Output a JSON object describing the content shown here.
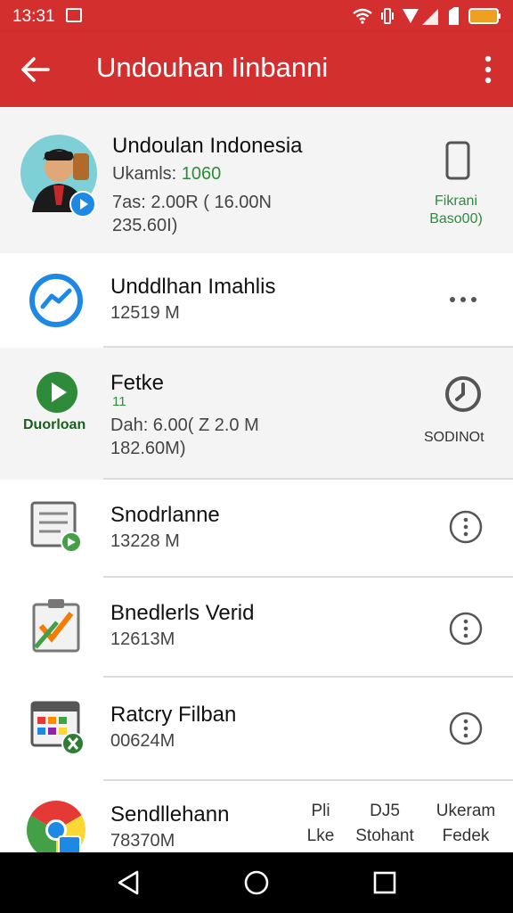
{
  "status_bar": {
    "time": "13:31",
    "icons": [
      "image-notification-icon",
      "wifi-icon",
      "vibrate-icon",
      "signal-icon",
      "sim-icon",
      "battery-icon"
    ],
    "color": "#d32f2f"
  },
  "app_bar": {
    "title": "Undouhan Iinbanni",
    "back_icon": "arrow-back-icon",
    "menu_icon": "more-vert-icon"
  },
  "items": [
    {
      "title": "Undoulan Indonesia",
      "line1_label": "Ukamls:",
      "line1_value": "1060",
      "line2": "7as: 2.00R ( 16.00N",
      "line3": "235.60I)",
      "action_label_1": "Fikrani",
      "action_label_2": "Baso00)",
      "icon": "avatar-photo",
      "action_icon": "phone-icon"
    },
    {
      "title": "Unddlhan Imahlis",
      "line1": "12519 M",
      "icon": "messenger-icon",
      "action_icon": "more-horiz-icon"
    },
    {
      "title": "Fetke",
      "badge": "11",
      "icon_label": "Duorloan",
      "line2": "Dah: 6.00( Z 2.0 M",
      "line3": "182.60M)",
      "action_label": "SODINOt",
      "icon": "play-icon",
      "action_icon": "power-clock-icon"
    },
    {
      "title": "Snodrlanne",
      "line1": "13228 M",
      "icon": "document-icon",
      "action_icon": "more-vert-circle-icon"
    },
    {
      "title": "Bnedlerls Verid",
      "line1": "12613M",
      "icon": "clipboard-icon",
      "action_icon": "more-vert-circle-icon"
    },
    {
      "title": "Ratcry Filban",
      "line1": "00624M",
      "icon": "calendar-icon",
      "action_icon": "more-vert-circle-icon"
    },
    {
      "title": "Sendllehann",
      "line1": "78370M",
      "icon": "chrome-icon",
      "actions": [
        {
          "top": "Pli",
          "bottom": "Lke"
        },
        {
          "top": "DJ5",
          "bottom": "Stohant"
        },
        {
          "top": "Ukeram",
          "bottom": "Fedek"
        }
      ]
    }
  ],
  "nav_bar": {
    "buttons": [
      "back-triangle-icon",
      "home-circle-icon",
      "recents-square-icon"
    ]
  }
}
